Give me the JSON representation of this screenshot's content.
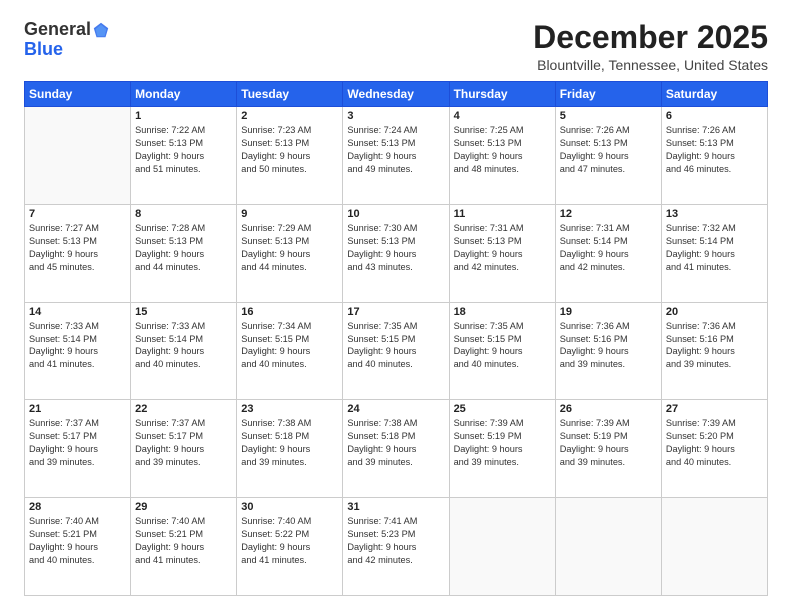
{
  "logo": {
    "general": "General",
    "blue": "Blue"
  },
  "header": {
    "month_title": "December 2025",
    "subtitle": "Blountville, Tennessee, United States"
  },
  "days_of_week": [
    "Sunday",
    "Monday",
    "Tuesday",
    "Wednesday",
    "Thursday",
    "Friday",
    "Saturday"
  ],
  "weeks": [
    [
      {
        "day": "",
        "content": ""
      },
      {
        "day": "1",
        "content": "Sunrise: 7:22 AM\nSunset: 5:13 PM\nDaylight: 9 hours\nand 51 minutes."
      },
      {
        "day": "2",
        "content": "Sunrise: 7:23 AM\nSunset: 5:13 PM\nDaylight: 9 hours\nand 50 minutes."
      },
      {
        "day": "3",
        "content": "Sunrise: 7:24 AM\nSunset: 5:13 PM\nDaylight: 9 hours\nand 49 minutes."
      },
      {
        "day": "4",
        "content": "Sunrise: 7:25 AM\nSunset: 5:13 PM\nDaylight: 9 hours\nand 48 minutes."
      },
      {
        "day": "5",
        "content": "Sunrise: 7:26 AM\nSunset: 5:13 PM\nDaylight: 9 hours\nand 47 minutes."
      },
      {
        "day": "6",
        "content": "Sunrise: 7:26 AM\nSunset: 5:13 PM\nDaylight: 9 hours\nand 46 minutes."
      }
    ],
    [
      {
        "day": "7",
        "content": "Sunrise: 7:27 AM\nSunset: 5:13 PM\nDaylight: 9 hours\nand 45 minutes."
      },
      {
        "day": "8",
        "content": "Sunrise: 7:28 AM\nSunset: 5:13 PM\nDaylight: 9 hours\nand 44 minutes."
      },
      {
        "day": "9",
        "content": "Sunrise: 7:29 AM\nSunset: 5:13 PM\nDaylight: 9 hours\nand 44 minutes."
      },
      {
        "day": "10",
        "content": "Sunrise: 7:30 AM\nSunset: 5:13 PM\nDaylight: 9 hours\nand 43 minutes."
      },
      {
        "day": "11",
        "content": "Sunrise: 7:31 AM\nSunset: 5:13 PM\nDaylight: 9 hours\nand 42 minutes."
      },
      {
        "day": "12",
        "content": "Sunrise: 7:31 AM\nSunset: 5:14 PM\nDaylight: 9 hours\nand 42 minutes."
      },
      {
        "day": "13",
        "content": "Sunrise: 7:32 AM\nSunset: 5:14 PM\nDaylight: 9 hours\nand 41 minutes."
      }
    ],
    [
      {
        "day": "14",
        "content": "Sunrise: 7:33 AM\nSunset: 5:14 PM\nDaylight: 9 hours\nand 41 minutes."
      },
      {
        "day": "15",
        "content": "Sunrise: 7:33 AM\nSunset: 5:14 PM\nDaylight: 9 hours\nand 40 minutes."
      },
      {
        "day": "16",
        "content": "Sunrise: 7:34 AM\nSunset: 5:15 PM\nDaylight: 9 hours\nand 40 minutes."
      },
      {
        "day": "17",
        "content": "Sunrise: 7:35 AM\nSunset: 5:15 PM\nDaylight: 9 hours\nand 40 minutes."
      },
      {
        "day": "18",
        "content": "Sunrise: 7:35 AM\nSunset: 5:15 PM\nDaylight: 9 hours\nand 40 minutes."
      },
      {
        "day": "19",
        "content": "Sunrise: 7:36 AM\nSunset: 5:16 PM\nDaylight: 9 hours\nand 39 minutes."
      },
      {
        "day": "20",
        "content": "Sunrise: 7:36 AM\nSunset: 5:16 PM\nDaylight: 9 hours\nand 39 minutes."
      }
    ],
    [
      {
        "day": "21",
        "content": "Sunrise: 7:37 AM\nSunset: 5:17 PM\nDaylight: 9 hours\nand 39 minutes."
      },
      {
        "day": "22",
        "content": "Sunrise: 7:37 AM\nSunset: 5:17 PM\nDaylight: 9 hours\nand 39 minutes."
      },
      {
        "day": "23",
        "content": "Sunrise: 7:38 AM\nSunset: 5:18 PM\nDaylight: 9 hours\nand 39 minutes."
      },
      {
        "day": "24",
        "content": "Sunrise: 7:38 AM\nSunset: 5:18 PM\nDaylight: 9 hours\nand 39 minutes."
      },
      {
        "day": "25",
        "content": "Sunrise: 7:39 AM\nSunset: 5:19 PM\nDaylight: 9 hours\nand 39 minutes."
      },
      {
        "day": "26",
        "content": "Sunrise: 7:39 AM\nSunset: 5:19 PM\nDaylight: 9 hours\nand 39 minutes."
      },
      {
        "day": "27",
        "content": "Sunrise: 7:39 AM\nSunset: 5:20 PM\nDaylight: 9 hours\nand 40 minutes."
      }
    ],
    [
      {
        "day": "28",
        "content": "Sunrise: 7:40 AM\nSunset: 5:21 PM\nDaylight: 9 hours\nand 40 minutes."
      },
      {
        "day": "29",
        "content": "Sunrise: 7:40 AM\nSunset: 5:21 PM\nDaylight: 9 hours\nand 41 minutes."
      },
      {
        "day": "30",
        "content": "Sunrise: 7:40 AM\nSunset: 5:22 PM\nDaylight: 9 hours\nand 41 minutes."
      },
      {
        "day": "31",
        "content": "Sunrise: 7:41 AM\nSunset: 5:23 PM\nDaylight: 9 hours\nand 42 minutes."
      },
      {
        "day": "",
        "content": ""
      },
      {
        "day": "",
        "content": ""
      },
      {
        "day": "",
        "content": ""
      }
    ]
  ]
}
